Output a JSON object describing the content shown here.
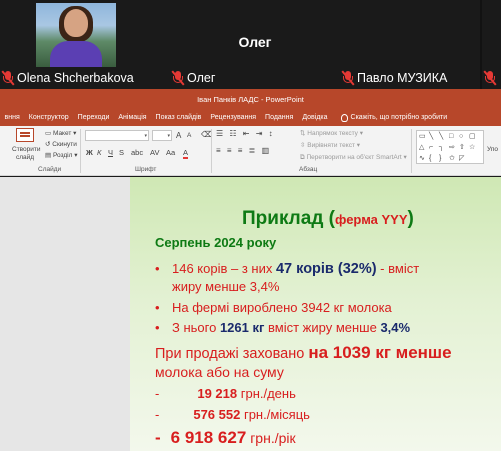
{
  "participants": [
    {
      "name": "Olena Shcherbakova",
      "muted": true
    },
    {
      "name": "Олег",
      "muted": true,
      "display_name": "Олег"
    },
    {
      "name": "Павло МУЗИКА",
      "muted": true
    }
  ],
  "powerpoint": {
    "window_title": "Іван Панків ЛАДС  -  PowerPoint",
    "tabs": [
      "вння",
      "Конструктор",
      "Переходи",
      "Анімація",
      "Показ слайдів",
      "Рецензування",
      "Подання",
      "Довідка"
    ],
    "tell_me": "Скажіть, що потрібно зробити",
    "ribbon": {
      "new_slide": "Створити",
      "new_slide_2": "слайд",
      "layout": "Макет",
      "reset": "Скинути",
      "section": "Розділ",
      "group_slides": "Слайди",
      "group_font": "Шрифт",
      "group_paragraph": "Абзац",
      "text_direction": "Напрямок тексту",
      "align_text": "Вирівняти текст",
      "smartart": "Перетворити на об'єкт SmartArt",
      "bold": "Ж",
      "italic": "К",
      "underline": "Ч",
      "strike": "S",
      "font_color": "А",
      "font_size_up": "А",
      "font_size_down": "А",
      "edge_label": "Упо"
    }
  },
  "slide": {
    "title_main": "Приклад (",
    "title_farm": "ферма YYY",
    "title_close": ")",
    "subtitle": "Серпень 2024 року",
    "bullet1_a": "146 корів – з них ",
    "bullet1_b": "47 корів (32%)",
    "bullet1_c": " -  вміст",
    "bullet1_d": "жиру менше 3,4%",
    "bullet2": "На фермі вироблено 3942 кг молока",
    "bullet3_a": "З нього ",
    "bullet3_b": "1261 кг",
    "bullet3_c": " вміст жиру менше ",
    "bullet3_d": "3,4%",
    "loss_a": "При продажі заховано ",
    "loss_b": "на 1039 кг менше",
    "loss_c": "молока або на суму",
    "sum1_value": "19 218",
    "sum1_unit": " грн./день",
    "sum2_value": "576  552",
    "sum2_unit": " грн./місяць",
    "sum3_value": "6 918 627",
    "sum3_unit": " грн./рік",
    "dash": "-",
    "bullet_mark": "•"
  },
  "colors": {
    "ppt_accent": "#b7472a",
    "slide_green": "#0e7a14",
    "slide_red": "#d81e1e",
    "slide_navy": "#1a2a6c",
    "mic_muted": "#e53935"
  }
}
